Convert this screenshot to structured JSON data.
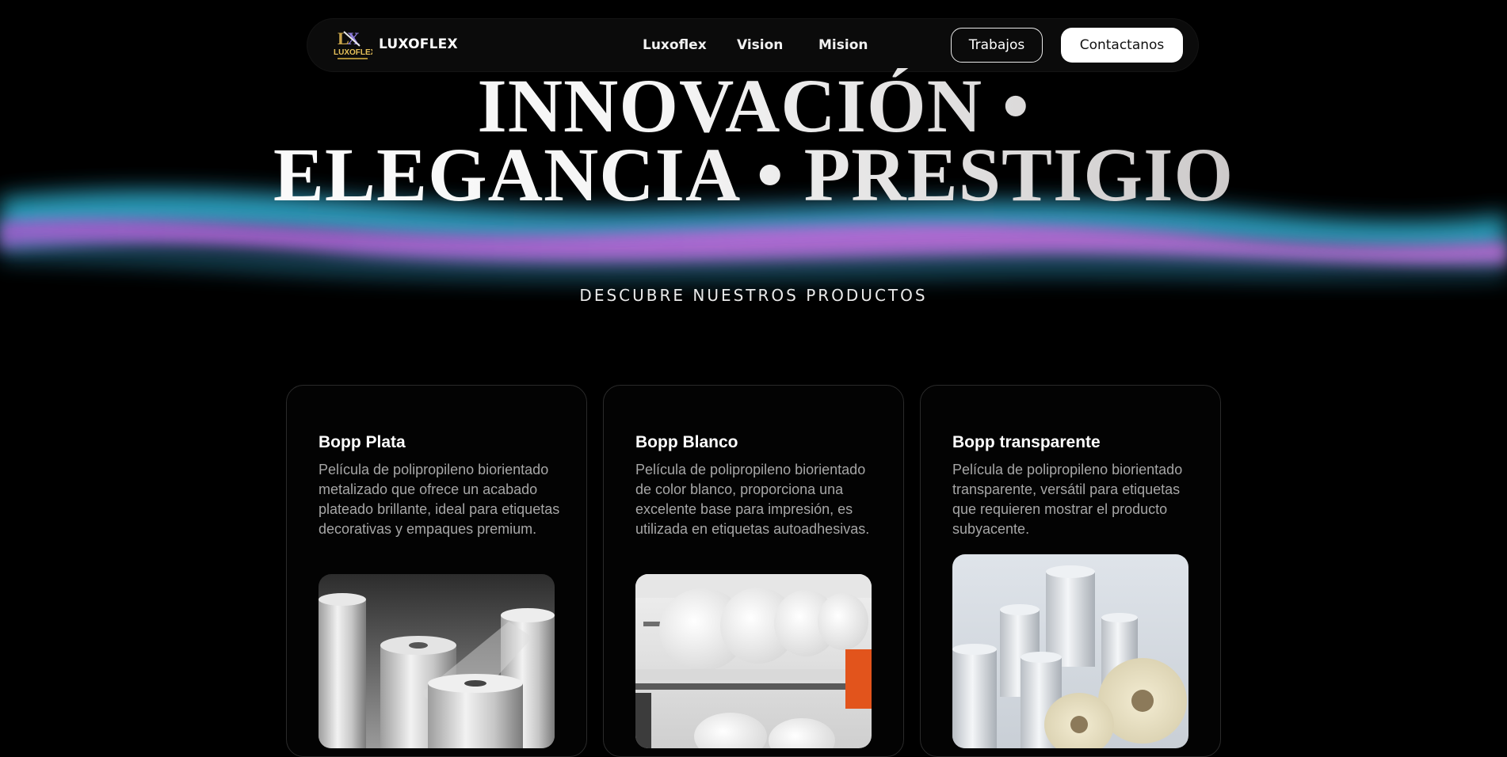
{
  "nav": {
    "brand": "LUXOFLEX",
    "logo_caption": "LUXOFLEX",
    "links": [
      "Luxoflex",
      "Vision",
      "Mision"
    ],
    "outline_button": "Trabajos",
    "cta_button": "Contactanos"
  },
  "hero": {
    "line1": "INNOVACIÓN •",
    "line2": "ELEGANCIA • PRESTIGIO",
    "subtitle": "DESCUBRE NUESTROS PRODUCTOS"
  },
  "products": [
    {
      "title": "Bopp Plata",
      "description": "Película de polipropileno biorientado metalizado que ofrece un acabado plateado brillante, ideal para etiquetas decorativas y empaques premium.",
      "image": "silver-film-rolls"
    },
    {
      "title": "Bopp Blanco",
      "description": "Película de polipropileno biorientado de color blanco, proporciona una excelente base para impresión, es utilizada en etiquetas autoadhesivas.",
      "image": "white-film-rolls"
    },
    {
      "title": "Bopp transparente",
      "description": "Película de polipropileno biorientado transparente, versátil para etiquetas que requieren mostrar el producto subyacente.",
      "image": "transparent-film-rolls"
    }
  ],
  "colors": {
    "background": "#000000",
    "wave_cyan": "#2fb8d8",
    "wave_magenta": "#c05ad8",
    "card_border": "#2a2a2a",
    "muted_text": "#a6a6a6"
  }
}
